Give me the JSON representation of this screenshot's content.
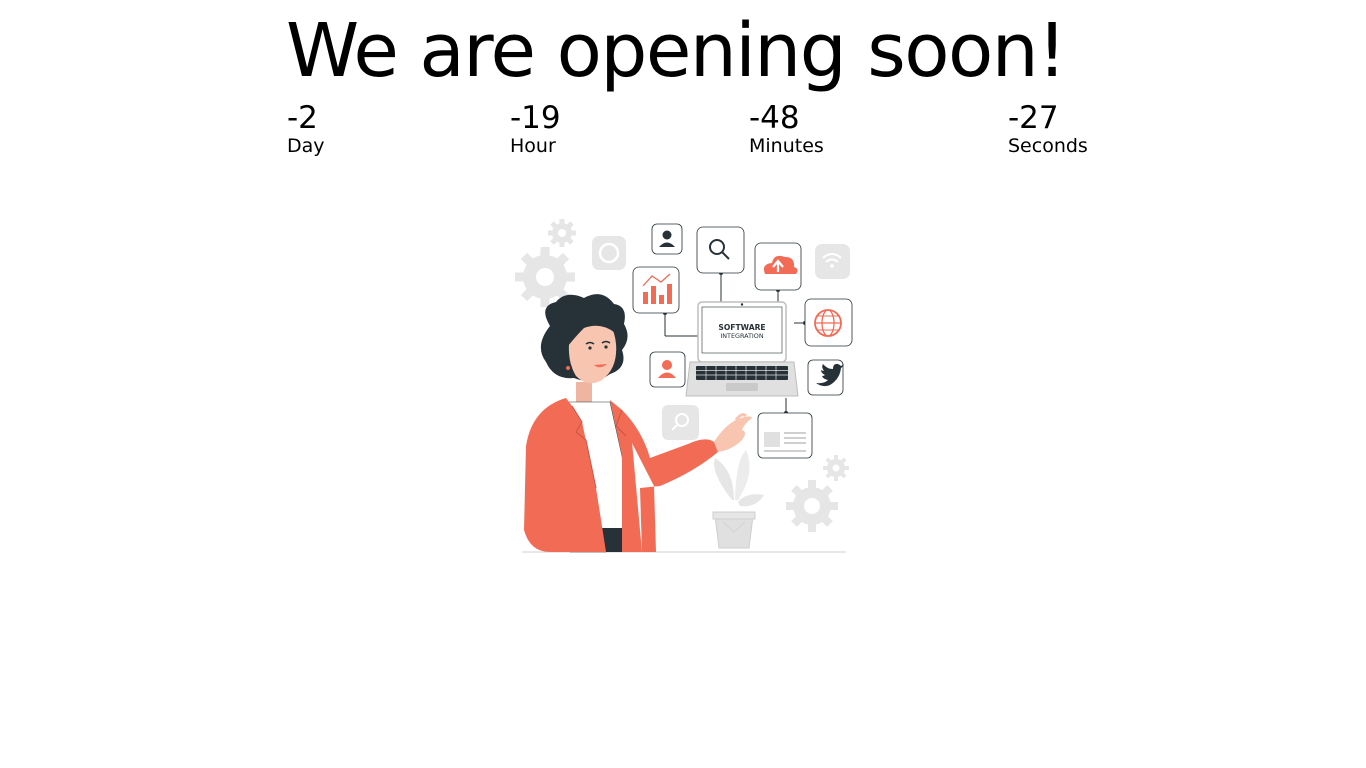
{
  "headline": "We are opening soon!",
  "countdown": [
    {
      "value": "-2",
      "label": "Day"
    },
    {
      "value": "-19",
      "label": "Hour"
    },
    {
      "value": "-48",
      "label": "Minutes"
    },
    {
      "value": "-27",
      "label": "Seconds"
    }
  ],
  "illustration": {
    "laptop_text_line1": "SOFTWARE",
    "laptop_text_line2": "INTEGRATION",
    "accent_color": "#f26b55",
    "dark_color": "#263238",
    "light_gray": "#e6e6e6"
  }
}
